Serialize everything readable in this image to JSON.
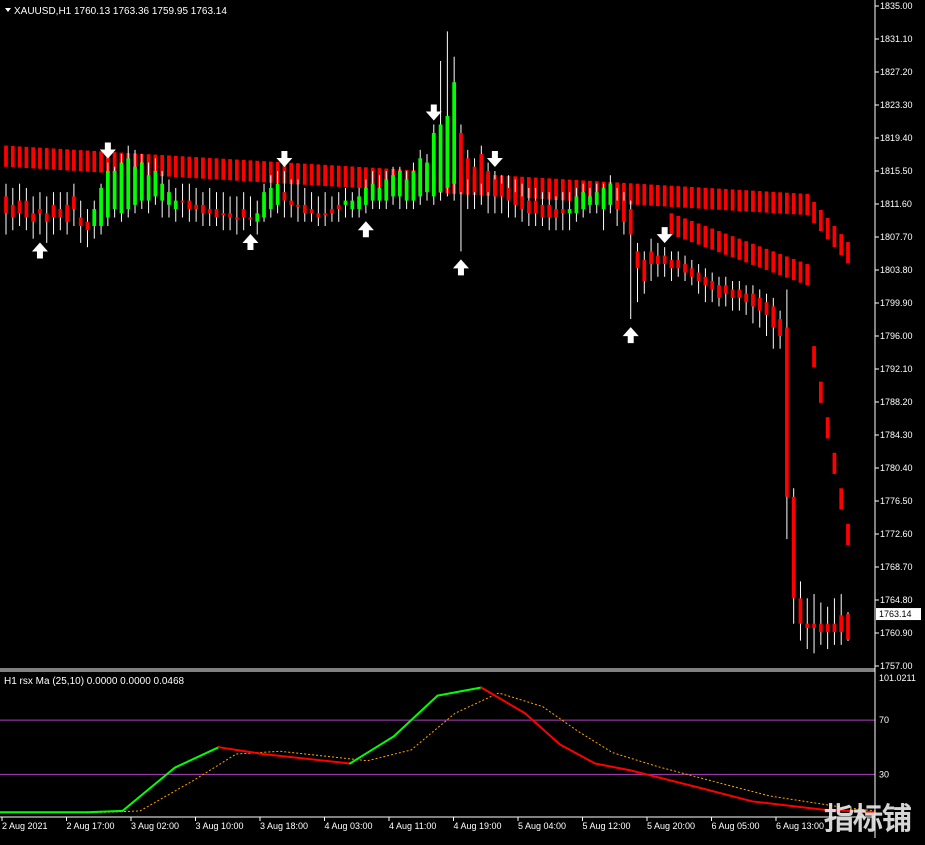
{
  "header": {
    "symbol": "XAUUSD,H1",
    "ohlc": "1760.13 1763.36 1759.95 1763.14",
    "sub_title": "H1 rsx Ma (25,10) 0.0000 0.0000 0.0468"
  },
  "price_tag": "1763.14",
  "watermark": "指标铺",
  "colors": {
    "bull": "#00ff00",
    "bear": "#ff0000",
    "wick": "#ffffff",
    "grid": "#ffffff",
    "level": "#b040c0",
    "signal": "#ffa500"
  },
  "chart_data": [
    {
      "type": "candlestick",
      "name": "XAUUSD,H1",
      "yticks": [
        1835.0,
        1831.1,
        1827.2,
        1823.3,
        1819.4,
        1815.5,
        1811.6,
        1807.7,
        1803.8,
        1799.9,
        1796.0,
        1792.1,
        1788.2,
        1784.3,
        1780.4,
        1776.5,
        1772.6,
        1768.7,
        1764.8,
        1760.9,
        1757.0
      ],
      "ylim": [
        1757.0,
        1835.0
      ],
      "xticks": [
        "2 Aug 2021",
        "2 Aug 17:00",
        "3 Aug 02:00",
        "3 Aug 10:00",
        "3 Aug 18:00",
        "4 Aug 03:00",
        "4 Aug 11:00",
        "4 Aug 19:00",
        "5 Aug 04:00",
        "5 Aug 12:00",
        "5 Aug 20:00",
        "6 Aug 05:00",
        "6 Aug 13:00"
      ],
      "last_price": 1763.14,
      "bars": [
        {
          "o": 1812.5,
          "h": 1814.0,
          "l": 1808.0,
          "c": 1810.5,
          "t": 0
        },
        {
          "o": 1811.5,
          "h": 1813.5,
          "l": 1808.5,
          "c": 1810.0,
          "t": 0
        },
        {
          "o": 1812.0,
          "h": 1814.0,
          "l": 1809.0,
          "c": 1810.5,
          "t": 0
        },
        {
          "o": 1812.0,
          "h": 1813.5,
          "l": 1808.5,
          "c": 1810.0,
          "t": 0
        },
        {
          "o": 1810.5,
          "h": 1812.5,
          "l": 1807.5,
          "c": 1809.5,
          "t": 0
        },
        {
          "o": 1810.5,
          "h": 1813.0,
          "l": 1808.0,
          "c": 1811.0,
          "t": 0
        },
        {
          "o": 1809.5,
          "h": 1812.5,
          "l": 1807.0,
          "c": 1810.5,
          "t": 0
        },
        {
          "o": 1810.0,
          "h": 1813.0,
          "l": 1808.0,
          "c": 1811.5,
          "t": 0
        },
        {
          "o": 1811.0,
          "h": 1813.0,
          "l": 1808.5,
          "c": 1810.0,
          "t": 0
        },
        {
          "o": 1809.5,
          "h": 1813.0,
          "l": 1808.0,
          "c": 1811.5,
          "t": 0
        },
        {
          "o": 1811.0,
          "h": 1814.0,
          "l": 1809.0,
          "c": 1812.5,
          "t": 0
        },
        {
          "o": 1809.0,
          "h": 1812.0,
          "l": 1807.0,
          "c": 1810.0,
          "t": 0
        },
        {
          "o": 1808.5,
          "h": 1811.0,
          "l": 1806.5,
          "c": 1809.5,
          "t": 0
        },
        {
          "o": 1809.0,
          "h": 1812.0,
          "l": 1807.5,
          "c": 1811.0,
          "t": 1
        },
        {
          "o": 1809.0,
          "h": 1814.0,
          "l": 1808.0,
          "c": 1813.5,
          "t": 1
        },
        {
          "o": 1810.0,
          "h": 1816.5,
          "l": 1809.0,
          "c": 1815.5,
          "t": 1
        },
        {
          "o": 1811.0,
          "h": 1816.0,
          "l": 1810.0,
          "c": 1815.5,
          "t": 1
        },
        {
          "o": 1810.5,
          "h": 1817.5,
          "l": 1809.5,
          "c": 1816.5,
          "t": 1
        },
        {
          "o": 1811.0,
          "h": 1818.5,
          "l": 1810.0,
          "c": 1817.0,
          "t": 1
        },
        {
          "o": 1811.5,
          "h": 1818.0,
          "l": 1810.5,
          "c": 1816.0,
          "t": 1
        },
        {
          "o": 1812.0,
          "h": 1817.5,
          "l": 1811.0,
          "c": 1816.5,
          "t": 1
        },
        {
          "o": 1812.0,
          "h": 1816.5,
          "l": 1810.5,
          "c": 1815.0,
          "t": 1
        },
        {
          "o": 1812.5,
          "h": 1817.0,
          "l": 1811.5,
          "c": 1815.5,
          "t": 1
        },
        {
          "o": 1812.0,
          "h": 1815.5,
          "l": 1810.0,
          "c": 1814.0,
          "t": 1
        },
        {
          "o": 1811.5,
          "h": 1814.5,
          "l": 1810.0,
          "c": 1813.0,
          "t": 1
        },
        {
          "o": 1811.0,
          "h": 1813.5,
          "l": 1809.5,
          "c": 1812.0,
          "t": 1
        },
        {
          "o": 1812.0,
          "h": 1814.0,
          "l": 1810.0,
          "c": 1812.0,
          "t": 0
        },
        {
          "o": 1812.0,
          "h": 1814.0,
          "l": 1809.5,
          "c": 1811.0,
          "t": 0
        },
        {
          "o": 1811.5,
          "h": 1813.5,
          "l": 1809.5,
          "c": 1811.0,
          "t": 0
        },
        {
          "o": 1811.5,
          "h": 1813.0,
          "l": 1809.0,
          "c": 1810.5,
          "t": 0
        },
        {
          "o": 1811.0,
          "h": 1813.5,
          "l": 1809.0,
          "c": 1810.5,
          "t": 0
        },
        {
          "o": 1811.0,
          "h": 1813.0,
          "l": 1809.0,
          "c": 1810.0,
          "t": 0
        },
        {
          "o": 1810.5,
          "h": 1813.0,
          "l": 1808.5,
          "c": 1810.5,
          "t": 0
        },
        {
          "o": 1810.5,
          "h": 1812.5,
          "l": 1808.5,
          "c": 1810.0,
          "t": 0
        },
        {
          "o": 1810.0,
          "h": 1812.5,
          "l": 1808.0,
          "c": 1810.0,
          "t": 0
        },
        {
          "o": 1810.0,
          "h": 1813.0,
          "l": 1808.5,
          "c": 1811.0,
          "t": 0
        },
        {
          "o": 1810.0,
          "h": 1812.5,
          "l": 1809.0,
          "c": 1810.0,
          "t": 0
        },
        {
          "o": 1809.5,
          "h": 1812.0,
          "l": 1808.0,
          "c": 1810.5,
          "t": 1
        },
        {
          "o": 1810.0,
          "h": 1814.0,
          "l": 1809.5,
          "c": 1813.0,
          "t": 1
        },
        {
          "o": 1811.0,
          "h": 1815.0,
          "l": 1810.0,
          "c": 1813.5,
          "t": 1
        },
        {
          "o": 1811.5,
          "h": 1815.5,
          "l": 1810.5,
          "c": 1814.0,
          "t": 1
        },
        {
          "o": 1812.0,
          "h": 1815.5,
          "l": 1810.0,
          "c": 1813.0,
          "t": 0
        },
        {
          "o": 1812.0,
          "h": 1814.5,
          "l": 1810.0,
          "c": 1811.5,
          "t": 0
        },
        {
          "o": 1811.5,
          "h": 1814.5,
          "l": 1809.5,
          "c": 1811.5,
          "t": 0
        },
        {
          "o": 1811.5,
          "h": 1813.5,
          "l": 1809.5,
          "c": 1810.5,
          "t": 0
        },
        {
          "o": 1811.0,
          "h": 1813.0,
          "l": 1809.5,
          "c": 1810.5,
          "t": 0
        },
        {
          "o": 1810.5,
          "h": 1812.5,
          "l": 1809.0,
          "c": 1810.0,
          "t": 0
        },
        {
          "o": 1810.5,
          "h": 1813.0,
          "l": 1809.0,
          "c": 1810.5,
          "t": 0
        },
        {
          "o": 1810.5,
          "h": 1812.5,
          "l": 1809.5,
          "c": 1811.0,
          "t": 0
        },
        {
          "o": 1811.0,
          "h": 1813.0,
          "l": 1809.5,
          "c": 1811.5,
          "t": 0
        },
        {
          "o": 1811.5,
          "h": 1813.5,
          "l": 1810.0,
          "c": 1812.0,
          "t": 1
        },
        {
          "o": 1811.0,
          "h": 1813.0,
          "l": 1810.0,
          "c": 1812.0,
          "t": 1
        },
        {
          "o": 1811.0,
          "h": 1813.5,
          "l": 1810.0,
          "c": 1812.5,
          "t": 1
        },
        {
          "o": 1811.5,
          "h": 1814.5,
          "l": 1810.5,
          "c": 1813.5,
          "t": 1
        },
        {
          "o": 1812.0,
          "h": 1815.5,
          "l": 1811.0,
          "c": 1814.0,
          "t": 1
        },
        {
          "o": 1812.0,
          "h": 1815.0,
          "l": 1811.0,
          "c": 1813.5,
          "t": 1
        },
        {
          "o": 1812.0,
          "h": 1815.5,
          "l": 1811.0,
          "c": 1814.5,
          "t": 1
        },
        {
          "o": 1812.5,
          "h": 1816.0,
          "l": 1811.5,
          "c": 1815.0,
          "t": 1
        },
        {
          "o": 1812.5,
          "h": 1816.0,
          "l": 1811.0,
          "c": 1815.5,
          "t": 1
        },
        {
          "o": 1812.0,
          "h": 1815.5,
          "l": 1811.0,
          "c": 1814.5,
          "t": 1
        },
        {
          "o": 1812.0,
          "h": 1816.5,
          "l": 1811.0,
          "c": 1815.5,
          "t": 1
        },
        {
          "o": 1812.5,
          "h": 1818.0,
          "l": 1811.5,
          "c": 1817.0,
          "t": 1
        },
        {
          "o": 1813.0,
          "h": 1817.5,
          "l": 1812.0,
          "c": 1816.5,
          "t": 1
        },
        {
          "o": 1812.5,
          "h": 1821.0,
          "l": 1811.5,
          "c": 1820.0,
          "t": 1
        },
        {
          "o": 1813.0,
          "h": 1828.5,
          "l": 1812.0,
          "c": 1821.0,
          "t": 1
        },
        {
          "o": 1813.5,
          "h": 1832.0,
          "l": 1812.5,
          "c": 1822.0,
          "t": 1
        },
        {
          "o": 1814.0,
          "h": 1829.0,
          "l": 1812.0,
          "c": 1826.0,
          "t": 1
        },
        {
          "o": 1820.0,
          "h": 1821.0,
          "l": 1806.0,
          "c": 1813.0,
          "t": 0
        },
        {
          "o": 1817.0,
          "h": 1818.0,
          "l": 1811.0,
          "c": 1814.5,
          "t": 0
        },
        {
          "o": 1816.0,
          "h": 1817.0,
          "l": 1811.0,
          "c": 1813.0,
          "t": 0
        },
        {
          "o": 1817.5,
          "h": 1818.5,
          "l": 1811.5,
          "c": 1814.0,
          "t": 0
        },
        {
          "o": 1815.5,
          "h": 1816.5,
          "l": 1810.5,
          "c": 1813.0,
          "t": 0
        },
        {
          "o": 1814.5,
          "h": 1815.5,
          "l": 1810.5,
          "c": 1812.5,
          "t": 0
        },
        {
          "o": 1814.0,
          "h": 1815.0,
          "l": 1810.5,
          "c": 1812.5,
          "t": 0
        },
        {
          "o": 1813.5,
          "h": 1815.0,
          "l": 1810.0,
          "c": 1812.0,
          "t": 0
        },
        {
          "o": 1813.0,
          "h": 1814.5,
          "l": 1810.0,
          "c": 1811.5,
          "t": 0
        },
        {
          "o": 1812.5,
          "h": 1814.0,
          "l": 1809.5,
          "c": 1811.0,
          "t": 0
        },
        {
          "o": 1812.0,
          "h": 1813.5,
          "l": 1809.0,
          "c": 1810.5,
          "t": 0
        },
        {
          "o": 1812.0,
          "h": 1813.5,
          "l": 1809.0,
          "c": 1810.5,
          "t": 0
        },
        {
          "o": 1811.5,
          "h": 1813.0,
          "l": 1809.0,
          "c": 1810.0,
          "t": 0
        },
        {
          "o": 1811.5,
          "h": 1813.0,
          "l": 1808.5,
          "c": 1810.0,
          "t": 0
        },
        {
          "o": 1811.0,
          "h": 1812.5,
          "l": 1808.5,
          "c": 1810.0,
          "t": 0
        },
        {
          "o": 1811.0,
          "h": 1813.0,
          "l": 1808.5,
          "c": 1810.5,
          "t": 0
        },
        {
          "o": 1810.5,
          "h": 1813.0,
          "l": 1808.5,
          "c": 1811.0,
          "t": 1
        },
        {
          "o": 1810.5,
          "h": 1813.5,
          "l": 1809.5,
          "c": 1812.5,
          "t": 1
        },
        {
          "o": 1811.0,
          "h": 1814.0,
          "l": 1810.0,
          "c": 1813.0,
          "t": 1
        },
        {
          "o": 1811.5,
          "h": 1813.5,
          "l": 1810.5,
          "c": 1812.5,
          "t": 1
        },
        {
          "o": 1811.5,
          "h": 1814.0,
          "l": 1810.5,
          "c": 1813.0,
          "t": 1
        },
        {
          "o": 1811.0,
          "h": 1814.0,
          "l": 1808.5,
          "c": 1813.5,
          "t": 1
        },
        {
          "o": 1811.5,
          "h": 1815.0,
          "l": 1810.5,
          "c": 1814.0,
          "t": 1
        },
        {
          "o": 1812.0,
          "h": 1813.5,
          "l": 1809.0,
          "c": 1811.0,
          "t": 0
        },
        {
          "o": 1812.0,
          "h": 1813.0,
          "l": 1808.0,
          "c": 1809.5,
          "t": 0
        },
        {
          "o": 1811.0,
          "h": 1812.0,
          "l": 1798.0,
          "c": 1808.0,
          "t": 0
        },
        {
          "o": 1806.0,
          "h": 1807.0,
          "l": 1800.0,
          "c": 1804.0,
          "t": 0
        },
        {
          "o": 1805.0,
          "h": 1806.0,
          "l": 1801.0,
          "c": 1802.5,
          "t": 0
        },
        {
          "o": 1806.0,
          "h": 1807.5,
          "l": 1802.5,
          "c": 1804.5,
          "t": 0
        },
        {
          "o": 1805.5,
          "h": 1807.0,
          "l": 1803.0,
          "c": 1804.5,
          "t": 0
        },
        {
          "o": 1805.5,
          "h": 1806.5,
          "l": 1803.0,
          "c": 1804.5,
          "t": 0
        },
        {
          "o": 1805.0,
          "h": 1806.0,
          "l": 1802.5,
          "c": 1804.0,
          "t": 0
        },
        {
          "o": 1805.0,
          "h": 1806.0,
          "l": 1803.0,
          "c": 1804.0,
          "t": 0
        },
        {
          "o": 1804.5,
          "h": 1805.5,
          "l": 1802.5,
          "c": 1803.5,
          "t": 0
        },
        {
          "o": 1804.0,
          "h": 1805.0,
          "l": 1802.0,
          "c": 1803.0,
          "t": 0
        },
        {
          "o": 1803.5,
          "h": 1804.5,
          "l": 1801.0,
          "c": 1802.5,
          "t": 0
        },
        {
          "o": 1803.0,
          "h": 1804.0,
          "l": 1800.0,
          "c": 1802.0,
          "t": 0
        },
        {
          "o": 1802.5,
          "h": 1803.5,
          "l": 1800.0,
          "c": 1801.5,
          "t": 0
        },
        {
          "o": 1802.0,
          "h": 1803.0,
          "l": 1799.5,
          "c": 1800.5,
          "t": 0
        },
        {
          "o": 1802.0,
          "h": 1803.0,
          "l": 1799.5,
          "c": 1801.0,
          "t": 0
        },
        {
          "o": 1801.5,
          "h": 1802.5,
          "l": 1799.0,
          "c": 1800.5,
          "t": 0
        },
        {
          "o": 1801.5,
          "h": 1802.5,
          "l": 1799.0,
          "c": 1800.5,
          "t": 0
        },
        {
          "o": 1801.0,
          "h": 1802.0,
          "l": 1798.5,
          "c": 1800.0,
          "t": 0
        },
        {
          "o": 1801.0,
          "h": 1802.0,
          "l": 1797.5,
          "c": 1799.5,
          "t": 0
        },
        {
          "o": 1800.5,
          "h": 1801.5,
          "l": 1797.0,
          "c": 1799.0,
          "t": 0
        },
        {
          "o": 1800.0,
          "h": 1801.0,
          "l": 1796.0,
          "c": 1798.5,
          "t": 0
        },
        {
          "o": 1799.5,
          "h": 1800.5,
          "l": 1794.5,
          "c": 1797.0,
          "t": 0
        },
        {
          "o": 1798.0,
          "h": 1799.0,
          "l": 1794.5,
          "c": 1796.0,
          "t": 0
        },
        {
          "o": 1797.0,
          "h": 1801.5,
          "l": 1772.0,
          "c": 1777.0,
          "t": 0
        },
        {
          "o": 1777.0,
          "h": 1778.0,
          "l": 1762.0,
          "c": 1765.0,
          "t": 0
        },
        {
          "o": 1765.0,
          "h": 1767.0,
          "l": 1760.0,
          "c": 1762.0,
          "t": 0
        },
        {
          "o": 1762.0,
          "h": 1765.0,
          "l": 1759.0,
          "c": 1761.5,
          "t": 0
        },
        {
          "o": 1761.5,
          "h": 1765.5,
          "l": 1758.5,
          "c": 1762.0,
          "t": 0
        },
        {
          "o": 1762.0,
          "h": 1764.5,
          "l": 1759.5,
          "c": 1761.0,
          "t": 0
        },
        {
          "o": 1761.0,
          "h": 1764.0,
          "l": 1759.0,
          "c": 1762.0,
          "t": 0
        },
        {
          "o": 1762.0,
          "h": 1765.0,
          "l": 1759.5,
          "c": 1761.0,
          "t": 0
        },
        {
          "o": 1761.0,
          "h": 1765.5,
          "l": 1759.5,
          "c": 1763.0,
          "t": 0
        },
        {
          "o": 1760.13,
          "h": 1763.36,
          "l": 1759.95,
          "c": 1763.14,
          "t": 0
        }
      ],
      "signals": [
        {
          "i": 5,
          "dir": "up"
        },
        {
          "i": 15,
          "dir": "down"
        },
        {
          "i": 36,
          "dir": "up"
        },
        {
          "i": 41,
          "dir": "down"
        },
        {
          "i": 53,
          "dir": "up"
        },
        {
          "i": 63,
          "dir": "down"
        },
        {
          "i": 67,
          "dir": "up"
        },
        {
          "i": 72,
          "dir": "down"
        },
        {
          "i": 92,
          "dir": "up"
        },
        {
          "i": 97,
          "dir": "down"
        }
      ]
    },
    {
      "type": "line",
      "name": "H1 rsx Ma (25,10)",
      "ylim": [
        0,
        101.0211
      ],
      "yticks": [
        101.0211,
        70,
        30
      ],
      "levels": [
        70,
        30
      ],
      "series": [
        {
          "x": [
            0,
            0.1,
            0.14,
            0.2,
            0.25,
            0.3,
            0.4,
            0.45,
            0.5,
            0.55,
            0.6,
            0.64,
            0.68,
            0.72,
            0.8,
            0.86,
            0.94,
            1.0
          ],
          "values": [
            2,
            2,
            3,
            35,
            50,
            45,
            38,
            58,
            88,
            94,
            75,
            52,
            38,
            33,
            20,
            10,
            4,
            2
          ]
        },
        {
          "x": [
            0,
            0.12,
            0.16,
            0.22,
            0.27,
            0.32,
            0.42,
            0.47,
            0.52,
            0.57,
            0.62,
            0.66,
            0.7,
            0.75,
            0.82,
            0.88,
            0.96,
            1.0
          ],
          "values": [
            2,
            2,
            3,
            25,
            45,
            47,
            40,
            48,
            75,
            90,
            80,
            62,
            46,
            36,
            24,
            14,
            6,
            3
          ]
        }
      ]
    }
  ]
}
